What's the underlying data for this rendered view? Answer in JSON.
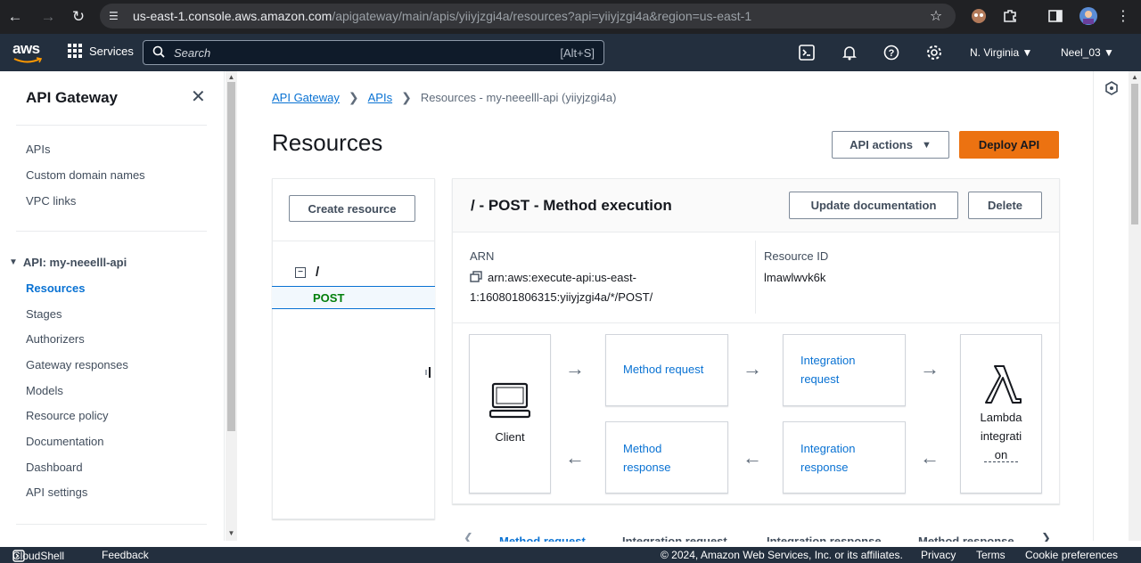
{
  "browser": {
    "url_host": "us-east-1.console.aws.amazon.com",
    "url_path": "/apigateway/main/apis/yiiyjzgi4a/resources?api=yiiyjzgi4a&region=us-east-1"
  },
  "topnav": {
    "logo": "aws",
    "services_label": "Services",
    "search_placeholder": "Search",
    "search_shortcut": "[Alt+S]",
    "region": "N. Virginia",
    "user": "Neel_03"
  },
  "sidebar": {
    "title": "API Gateway",
    "top_links": [
      "APIs",
      "Custom domain names",
      "VPC links"
    ],
    "section_label": "API: my-neeelll-api",
    "section_links": [
      "Resources",
      "Stages",
      "Authorizers",
      "Gateway responses",
      "Models",
      "Resource policy",
      "Documentation",
      "Dashboard",
      "API settings"
    ]
  },
  "breadcrumb": {
    "items": [
      "API Gateway",
      "APIs",
      "Resources - my-neeelll-api (yiiyjzgi4a)"
    ]
  },
  "page": {
    "title": "Resources",
    "api_actions_label": "API actions",
    "deploy_label": "Deploy API"
  },
  "tree": {
    "create_label": "Create resource",
    "root": "/",
    "method": "POST"
  },
  "method_panel": {
    "title": "/ - POST - Method execution",
    "update_doc_label": "Update documentation",
    "delete_label": "Delete",
    "arn_label": "ARN",
    "arn_line1": "arn:aws:execute-api:us-east-",
    "arn_line2": "1:160801806315:yiiyjzgi4a/*/POST/",
    "resource_id_label": "Resource ID",
    "resource_id": "lmawlwvk6k",
    "client_label": "Client",
    "method_request_1": "Method request",
    "integration_request_1": "Integration",
    "integration_request_2": "request",
    "method_response_1": "Method",
    "method_response_2": "response",
    "integration_response_1": "Integration",
    "integration_response_2": "response",
    "lambda_1": "Lambda",
    "lambda_2": "integrati",
    "lambda_3": "on"
  },
  "tabs_partial": [
    "Method request",
    "Integration request",
    "Integration response",
    "Method response"
  ],
  "footer": {
    "cloudshell": "CloudShell",
    "feedback": "Feedback",
    "copyright": "© 2024, Amazon Web Services, Inc. or its affiliates.",
    "privacy": "Privacy",
    "terms": "Terms",
    "cookies": "Cookie preferences"
  }
}
